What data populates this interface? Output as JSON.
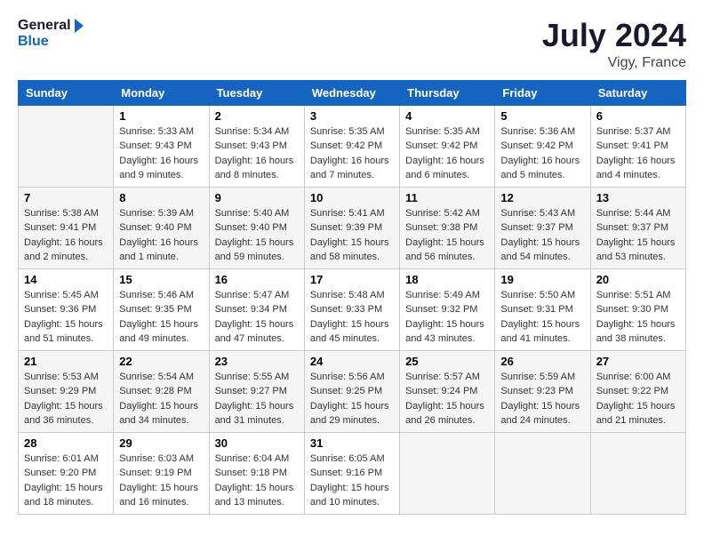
{
  "header": {
    "logo_line1": "General",
    "logo_line2": "Blue",
    "month_year": "July 2024",
    "location": "Vigy, France"
  },
  "columns": [
    "Sunday",
    "Monday",
    "Tuesday",
    "Wednesday",
    "Thursday",
    "Friday",
    "Saturday"
  ],
  "weeks": [
    [
      {
        "day": "",
        "info": ""
      },
      {
        "day": "1",
        "info": "Sunrise: 5:33 AM\nSunset: 9:43 PM\nDaylight: 16 hours\nand 9 minutes."
      },
      {
        "day": "2",
        "info": "Sunrise: 5:34 AM\nSunset: 9:43 PM\nDaylight: 16 hours\nand 8 minutes."
      },
      {
        "day": "3",
        "info": "Sunrise: 5:35 AM\nSunset: 9:42 PM\nDaylight: 16 hours\nand 7 minutes."
      },
      {
        "day": "4",
        "info": "Sunrise: 5:35 AM\nSunset: 9:42 PM\nDaylight: 16 hours\nand 6 minutes."
      },
      {
        "day": "5",
        "info": "Sunrise: 5:36 AM\nSunset: 9:42 PM\nDaylight: 16 hours\nand 5 minutes."
      },
      {
        "day": "6",
        "info": "Sunrise: 5:37 AM\nSunset: 9:41 PM\nDaylight: 16 hours\nand 4 minutes."
      }
    ],
    [
      {
        "day": "7",
        "info": "Sunrise: 5:38 AM\nSunset: 9:41 PM\nDaylight: 16 hours\nand 2 minutes."
      },
      {
        "day": "8",
        "info": "Sunrise: 5:39 AM\nSunset: 9:40 PM\nDaylight: 16 hours\nand 1 minute."
      },
      {
        "day": "9",
        "info": "Sunrise: 5:40 AM\nSunset: 9:40 PM\nDaylight: 15 hours\nand 59 minutes."
      },
      {
        "day": "10",
        "info": "Sunrise: 5:41 AM\nSunset: 9:39 PM\nDaylight: 15 hours\nand 58 minutes."
      },
      {
        "day": "11",
        "info": "Sunrise: 5:42 AM\nSunset: 9:38 PM\nDaylight: 15 hours\nand 56 minutes."
      },
      {
        "day": "12",
        "info": "Sunrise: 5:43 AM\nSunset: 9:37 PM\nDaylight: 15 hours\nand 54 minutes."
      },
      {
        "day": "13",
        "info": "Sunrise: 5:44 AM\nSunset: 9:37 PM\nDaylight: 15 hours\nand 53 minutes."
      }
    ],
    [
      {
        "day": "14",
        "info": "Sunrise: 5:45 AM\nSunset: 9:36 PM\nDaylight: 15 hours\nand 51 minutes."
      },
      {
        "day": "15",
        "info": "Sunrise: 5:46 AM\nSunset: 9:35 PM\nDaylight: 15 hours\nand 49 minutes."
      },
      {
        "day": "16",
        "info": "Sunrise: 5:47 AM\nSunset: 9:34 PM\nDaylight: 15 hours\nand 47 minutes."
      },
      {
        "day": "17",
        "info": "Sunrise: 5:48 AM\nSunset: 9:33 PM\nDaylight: 15 hours\nand 45 minutes."
      },
      {
        "day": "18",
        "info": "Sunrise: 5:49 AM\nSunset: 9:32 PM\nDaylight: 15 hours\nand 43 minutes."
      },
      {
        "day": "19",
        "info": "Sunrise: 5:50 AM\nSunset: 9:31 PM\nDaylight: 15 hours\nand 41 minutes."
      },
      {
        "day": "20",
        "info": "Sunrise: 5:51 AM\nSunset: 9:30 PM\nDaylight: 15 hours\nand 38 minutes."
      }
    ],
    [
      {
        "day": "21",
        "info": "Sunrise: 5:53 AM\nSunset: 9:29 PM\nDaylight: 15 hours\nand 36 minutes."
      },
      {
        "day": "22",
        "info": "Sunrise: 5:54 AM\nSunset: 9:28 PM\nDaylight: 15 hours\nand 34 minutes."
      },
      {
        "day": "23",
        "info": "Sunrise: 5:55 AM\nSunset: 9:27 PM\nDaylight: 15 hours\nand 31 minutes."
      },
      {
        "day": "24",
        "info": "Sunrise: 5:56 AM\nSunset: 9:25 PM\nDaylight: 15 hours\nand 29 minutes."
      },
      {
        "day": "25",
        "info": "Sunrise: 5:57 AM\nSunset: 9:24 PM\nDaylight: 15 hours\nand 26 minutes."
      },
      {
        "day": "26",
        "info": "Sunrise: 5:59 AM\nSunset: 9:23 PM\nDaylight: 15 hours\nand 24 minutes."
      },
      {
        "day": "27",
        "info": "Sunrise: 6:00 AM\nSunset: 9:22 PM\nDaylight: 15 hours\nand 21 minutes."
      }
    ],
    [
      {
        "day": "28",
        "info": "Sunrise: 6:01 AM\nSunset: 9:20 PM\nDaylight: 15 hours\nand 18 minutes."
      },
      {
        "day": "29",
        "info": "Sunrise: 6:03 AM\nSunset: 9:19 PM\nDaylight: 15 hours\nand 16 minutes."
      },
      {
        "day": "30",
        "info": "Sunrise: 6:04 AM\nSunset: 9:18 PM\nDaylight: 15 hours\nand 13 minutes."
      },
      {
        "day": "31",
        "info": "Sunrise: 6:05 AM\nSunset: 9:16 PM\nDaylight: 15 hours\nand 10 minutes."
      },
      {
        "day": "",
        "info": ""
      },
      {
        "day": "",
        "info": ""
      },
      {
        "day": "",
        "info": ""
      }
    ]
  ]
}
